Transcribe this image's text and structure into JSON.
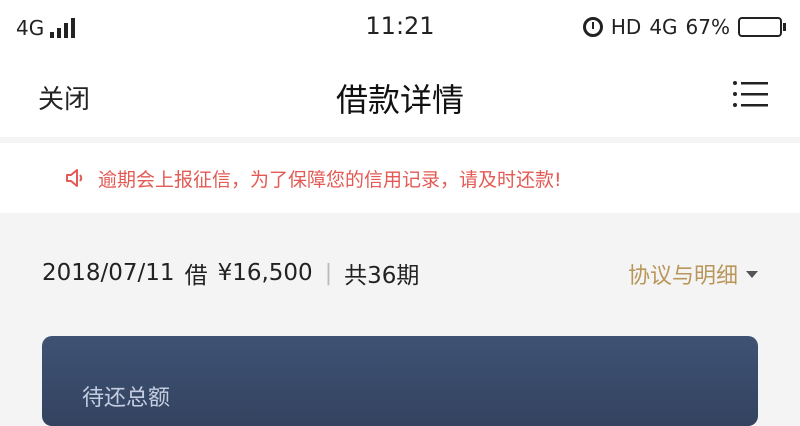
{
  "status_bar": {
    "network": "4G",
    "time": "11:21",
    "hd": "HD",
    "network_right": "4G",
    "battery": "67%",
    "battery_level": 0.67,
    "icons": [
      "signal-icon",
      "alarm-icon",
      "battery-icon"
    ]
  },
  "nav": {
    "close_label": "关闭",
    "title": "借款详情",
    "menu_icon": "list-menu-icon"
  },
  "notice": {
    "icon": "speaker-icon",
    "text": "逾期会上报征信，为了保障您的信用记录，请及时还款!",
    "color": "#e35a54"
  },
  "loan": {
    "date": "2018/07/11",
    "borrow_label": "借",
    "amount": "¥16,500",
    "separator": "|",
    "periods": "共36期",
    "agreement_label": "协议与明细",
    "agreement_color": "#b9975b"
  },
  "card": {
    "label": "待还总额",
    "color": "#3a4a68"
  }
}
